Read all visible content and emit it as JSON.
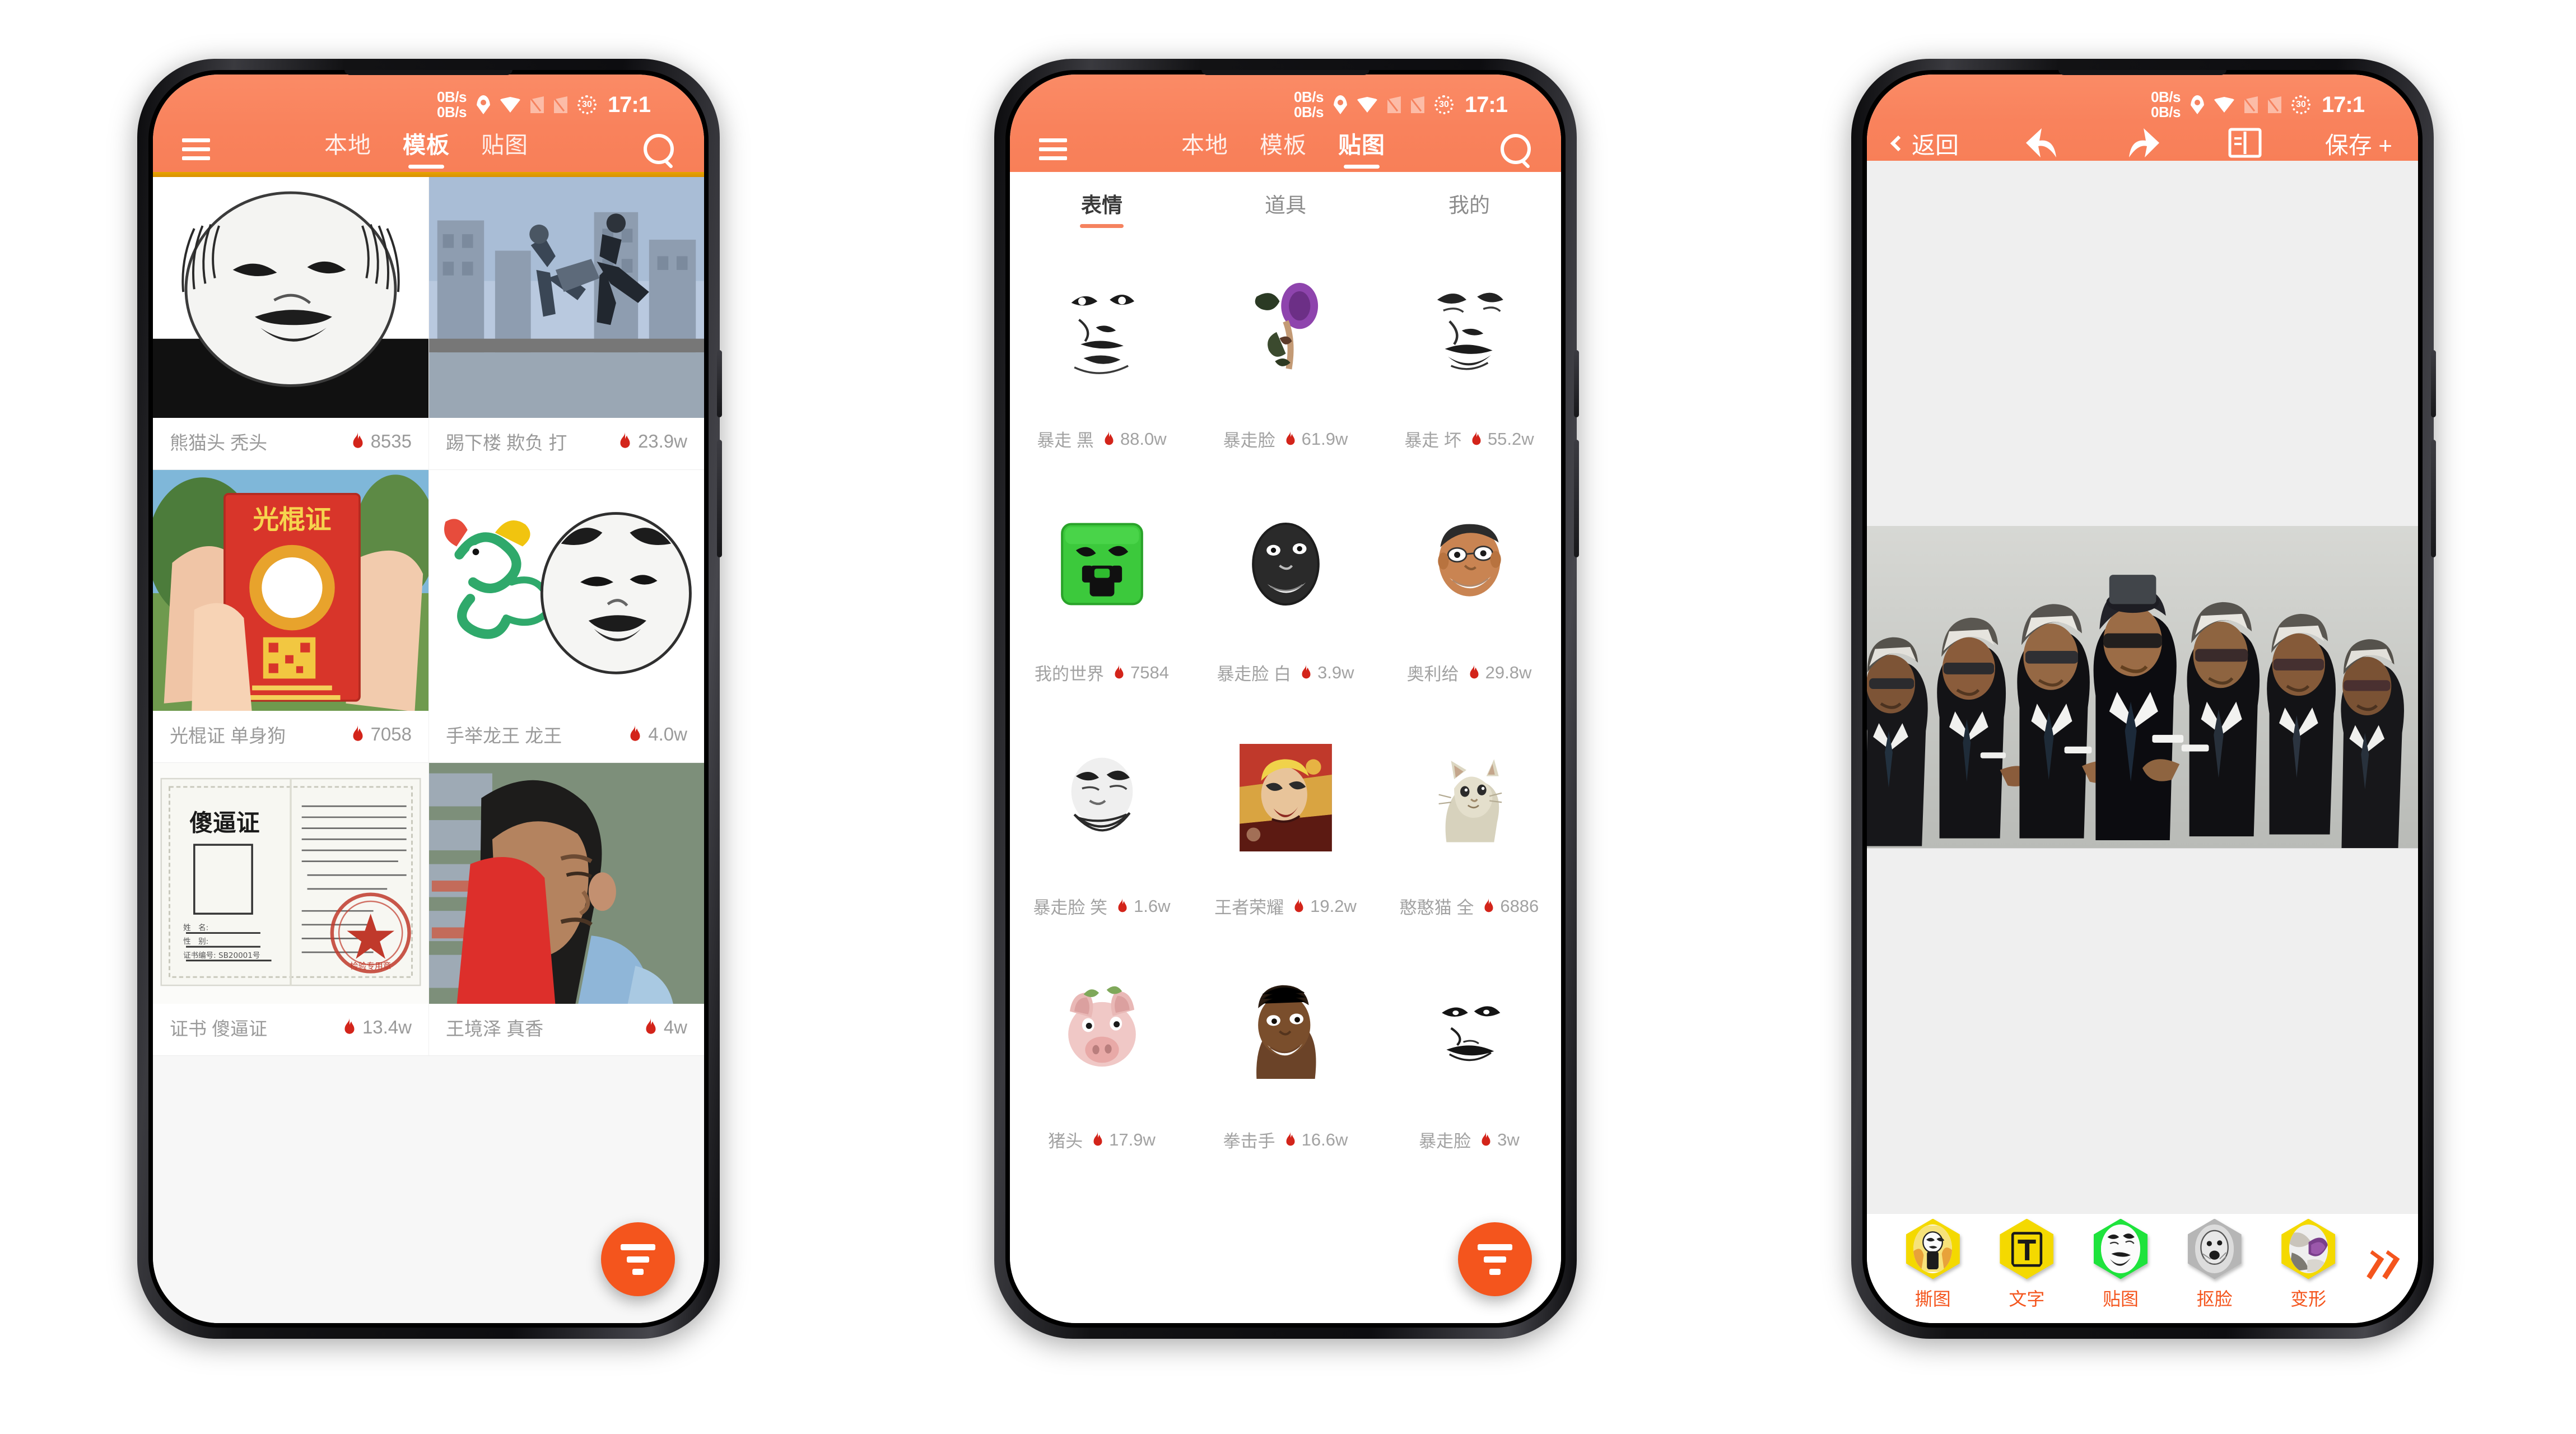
{
  "app": {
    "accent": "#f5825f",
    "accent_dark": "#f4551d",
    "gold": "#e8a400",
    "flame_color": "#d3241a"
  },
  "status_bar": {
    "net_speed_up": "0B/s",
    "net_speed_down": "0B/s",
    "battery_level": "30",
    "time": "17:1",
    "icons": [
      "location-pin-icon",
      "wifi-icon",
      "signal-off-icon",
      "signal-off-icon",
      "battery-icon"
    ]
  },
  "phone1": {
    "menu_icon": "hamburger-menu-icon",
    "search_icon": "search-icon",
    "tabs": [
      {
        "label": "本地",
        "active": false
      },
      {
        "label": "模板",
        "active": true
      },
      {
        "label": "贴图",
        "active": false
      }
    ],
    "templates": [
      {
        "name": "熊猫头 秃头",
        "hot": "8535",
        "art": "panda-head"
      },
      {
        "name": "踢下楼 欺负 打",
        "hot": "23.9w",
        "art": "kick-building"
      },
      {
        "name": "光棍证 单身狗",
        "hot": "7058",
        "art": "single-cert"
      },
      {
        "name": "手举龙王 龙王",
        "hot": "4.0w",
        "art": "dragon-king"
      },
      {
        "name": "证书 傻逼证",
        "hot": "13.4w",
        "art": "sb-cert"
      },
      {
        "name": "王境泽 真香",
        "hot": "4w",
        "art": "wang-jingze"
      }
    ],
    "fab": "filter-fab-button"
  },
  "phone2": {
    "menu_icon": "hamburger-menu-icon",
    "search_icon": "search-icon",
    "tabs": [
      {
        "label": "本地",
        "active": false
      },
      {
        "label": "模板",
        "active": false
      },
      {
        "label": "贴图",
        "active": true
      }
    ],
    "subtabs": [
      {
        "label": "表情",
        "active": true
      },
      {
        "label": "道具",
        "active": false
      },
      {
        "label": "我的",
        "active": false
      }
    ],
    "stickers": [
      {
        "name": "暴走 黑",
        "hot": "88.0w",
        "art": "rage-dark"
      },
      {
        "name": "暴走脸",
        "hot": "61.9w",
        "art": "rage-purple"
      },
      {
        "name": "暴走 坏",
        "hot": "55.2w",
        "art": "rage-evil"
      },
      {
        "name": "我的世界",
        "hot": "7584",
        "art": "minecraft-creeper"
      },
      {
        "name": "暴走脸 白",
        "hot": "3.9w",
        "art": "rage-grey-face"
      },
      {
        "name": "奥利给",
        "hot": "29.8w",
        "art": "aoligei"
      },
      {
        "name": "暴走脸 笑",
        "hot": "1.6w",
        "art": "rage-smile"
      },
      {
        "name": "王者荣耀",
        "hot": "19.2w",
        "art": "king-glory"
      },
      {
        "name": "憨憨猫 全",
        "hot": "6886",
        "art": "cat"
      },
      {
        "name": "猪头",
        "hot": "17.9w",
        "art": "pig-head"
      },
      {
        "name": "拳击手",
        "hot": "16.6w",
        "art": "boxer"
      },
      {
        "name": "暴走脸",
        "hot": "3w",
        "art": "rage-line"
      }
    ],
    "fab": "filter-fab-button"
  },
  "phone3": {
    "back_label": "返回",
    "save_label": "保存 +",
    "toolbar_icons": [
      "undo-icon",
      "redo-icon",
      "book-icon"
    ],
    "canvas_art": "coffin-dance-pallbearers",
    "tools": [
      {
        "label": "撕图",
        "icon": "tear-image-icon",
        "hex": "#f4d900",
        "art": "panda-tear"
      },
      {
        "label": "文字",
        "icon": "text-icon",
        "hex": "#f4d900",
        "art": "letter-T"
      },
      {
        "label": "贴图",
        "icon": "sticker-icon",
        "hex": "#1ee33c",
        "art": "rage-face"
      },
      {
        "label": "抠脸",
        "icon": "cutout-face-icon",
        "hex": "#b6b6b6",
        "art": "grey-face"
      },
      {
        "label": "变形",
        "icon": "deform-icon",
        "hex": "#f4d900",
        "art": "swirl"
      }
    ],
    "more_icon": "double-chevron-right-icon"
  }
}
